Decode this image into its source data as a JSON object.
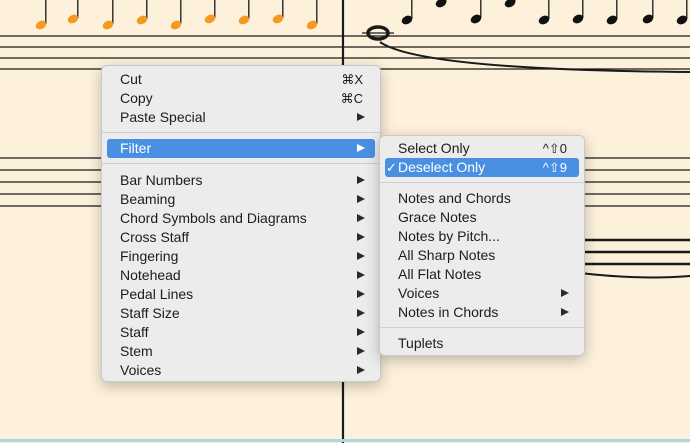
{
  "colors": {
    "page": "#fdf1dc",
    "highlight": "#4a90e2",
    "selected_note": "#f59a20"
  },
  "menu": {
    "cut": {
      "label": "Cut",
      "shortcut": "⌘X"
    },
    "copy": {
      "label": "Copy",
      "shortcut": "⌘C"
    },
    "paste_special": {
      "label": "Paste Special"
    },
    "filter": {
      "label": "Filter"
    },
    "items": [
      {
        "label": "Bar Numbers"
      },
      {
        "label": "Beaming"
      },
      {
        "label": "Chord Symbols and Diagrams"
      },
      {
        "label": "Cross Staff"
      },
      {
        "label": "Fingering"
      },
      {
        "label": "Notehead"
      },
      {
        "label": "Pedal Lines"
      },
      {
        "label": "Staff Size"
      },
      {
        "label": "Staff"
      },
      {
        "label": "Stem"
      },
      {
        "label": "Voices"
      }
    ]
  },
  "submenu": {
    "select_only": {
      "label": "Select Only",
      "shortcut": "^⇧0"
    },
    "deselect_only": {
      "label": "Deselect Only",
      "shortcut": "^⇧9",
      "check": "✓"
    },
    "items": [
      {
        "label": "Notes and Chords"
      },
      {
        "label": "Grace Notes"
      },
      {
        "label": "Notes by Pitch..."
      },
      {
        "label": "All Sharp Notes"
      },
      {
        "label": "All Flat Notes"
      },
      {
        "label": "Voices"
      },
      {
        "label": "Notes in Chords"
      }
    ],
    "tuplets": {
      "label": "Tuplets"
    }
  }
}
